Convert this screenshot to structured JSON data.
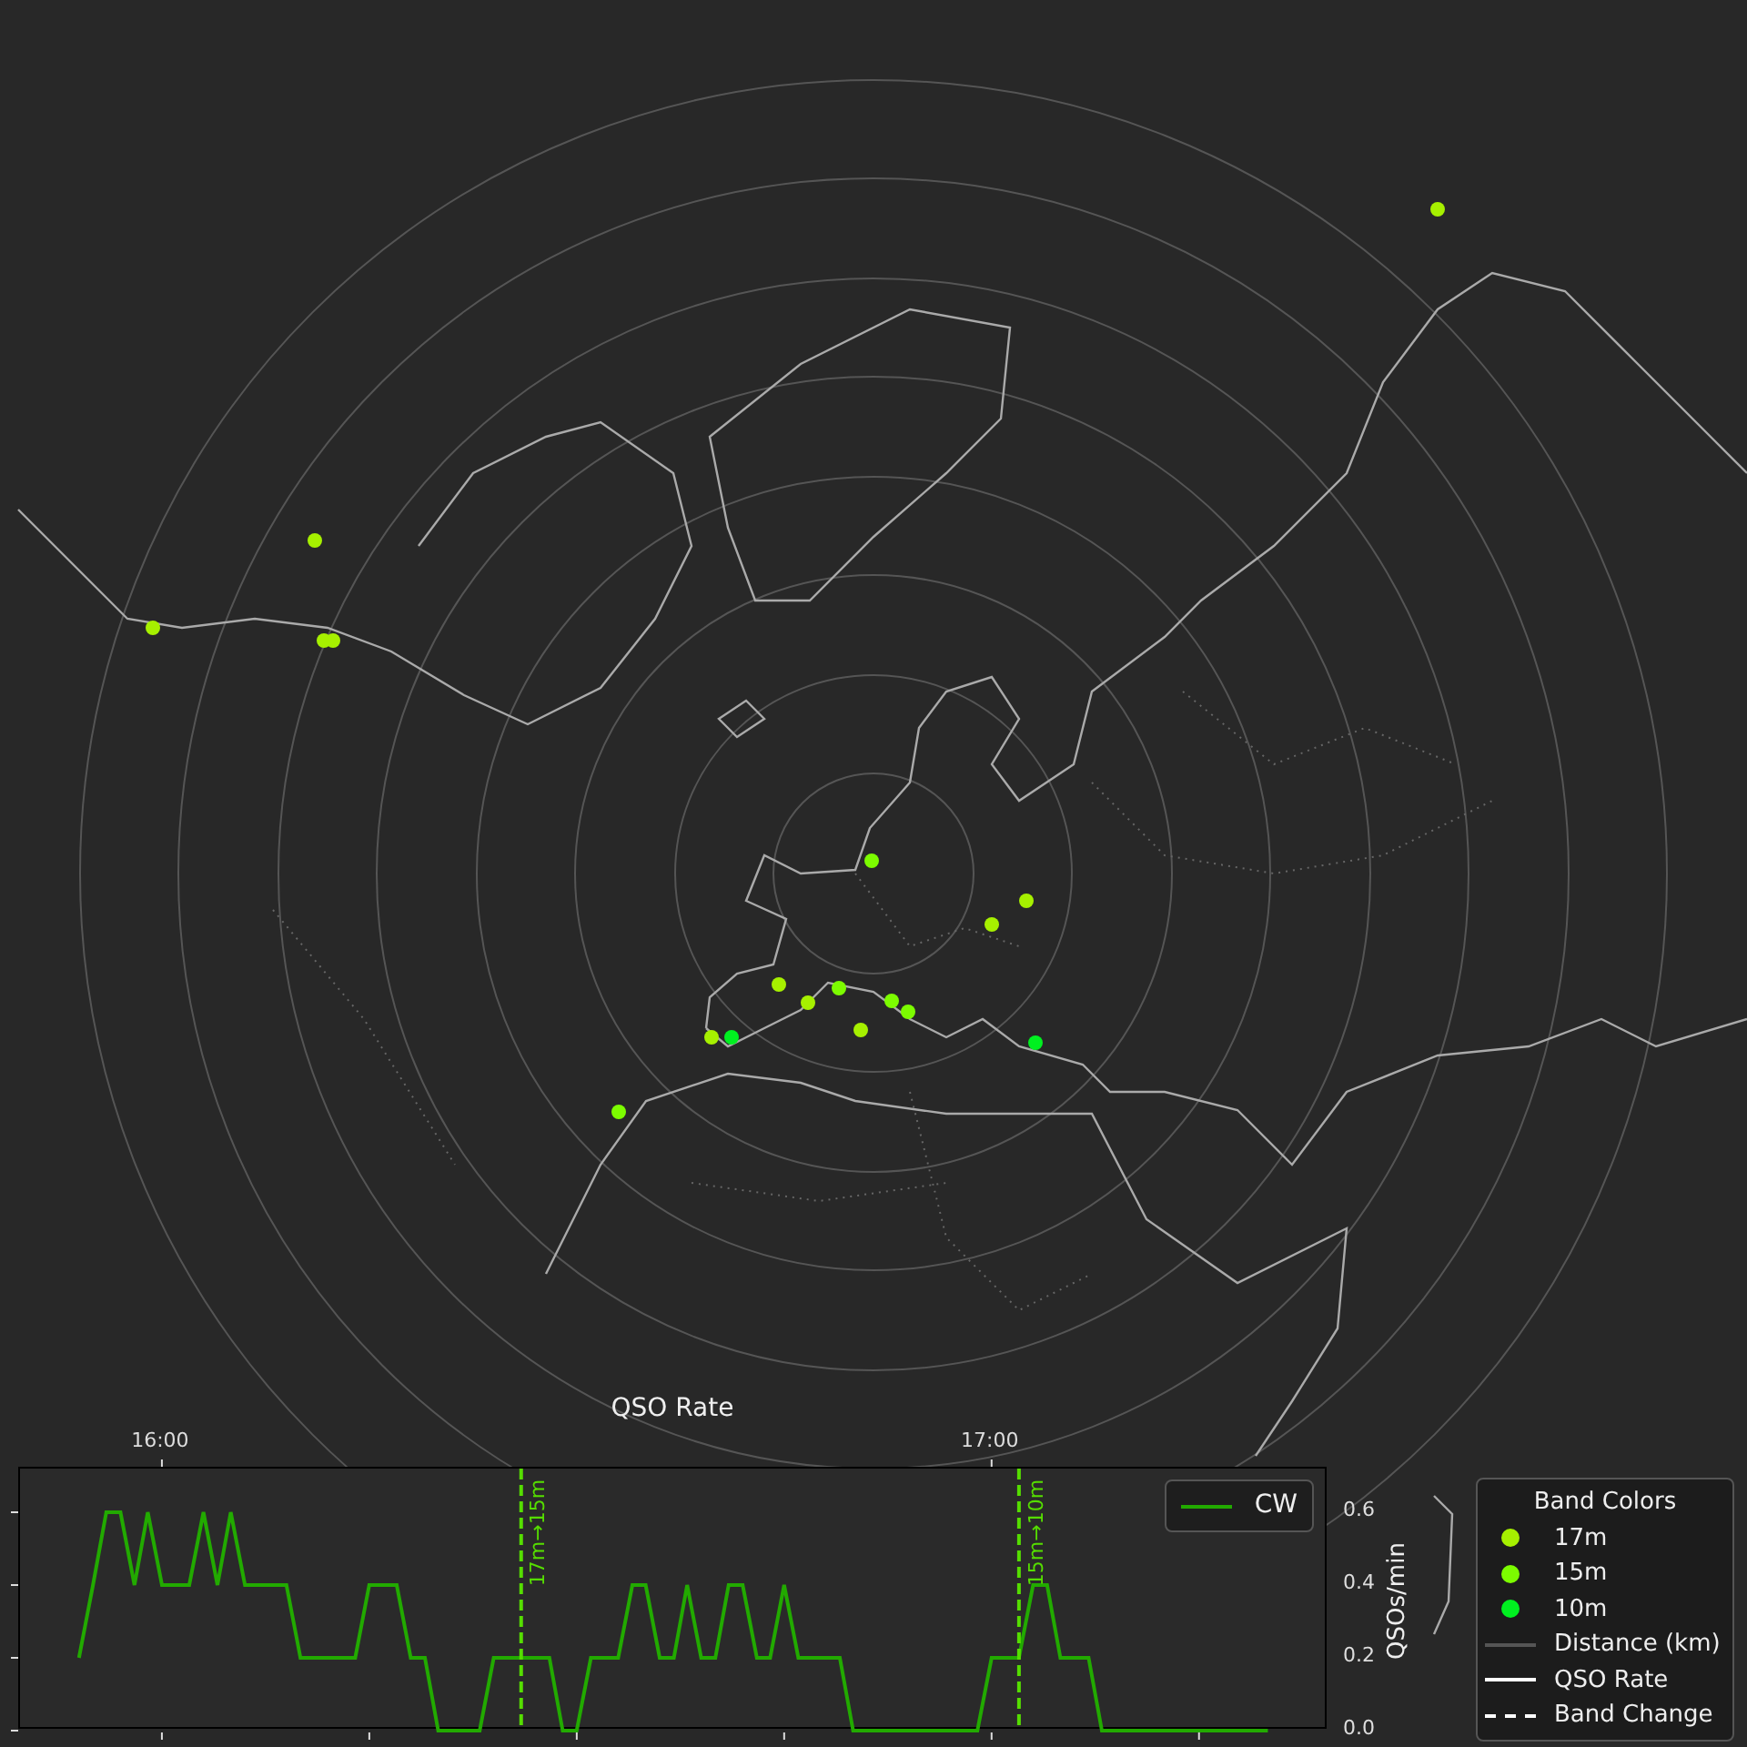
{
  "map": {
    "stations": [
      {
        "color": "#a6f000"
      },
      {
        "color": "#a6f000"
      },
      {
        "color": "#a6f000"
      },
      {
        "color": "#a6f000"
      },
      {
        "color": "#a6f000"
      },
      {
        "color": "#7cfc00"
      },
      {
        "color": "#a6f000"
      },
      {
        "color": "#a6f000"
      },
      {
        "color": "#a6f000"
      },
      {
        "color": "#7cfc00"
      },
      {
        "color": "#a6f000"
      },
      {
        "color": "#7cfc00"
      },
      {
        "color": "#7cfc00"
      },
      {
        "color": "#a6f000"
      },
      {
        "color": "#a6f000"
      },
      {
        "color": "#00f020"
      },
      {
        "color": "#00f020"
      },
      {
        "color": "#7cfc00"
      }
    ]
  },
  "qso_panel": {
    "chart_data": {
      "type": "line",
      "title": "QSO Rate",
      "ylabel": "QSOs/min",
      "x": [
        15.9,
        15.917,
        15.933,
        15.95,
        15.967,
        15.983,
        16,
        16.017,
        16.033,
        16.05,
        16.067,
        16.083,
        16.1,
        16.117,
        16.133,
        16.15,
        16.167,
        16.183,
        16.2,
        16.217,
        16.233,
        16.25,
        16.267,
        16.283,
        16.3,
        16.317,
        16.333,
        16.35,
        16.367,
        16.383,
        16.4,
        16.417,
        16.433,
        16.45,
        16.467,
        16.483,
        16.5,
        16.517,
        16.533,
        16.55,
        16.567,
        16.583,
        16.6,
        16.617,
        16.633,
        16.65,
        16.667,
        16.683,
        16.7,
        16.717,
        16.733,
        16.75,
        16.767,
        16.783,
        16.8,
        16.817,
        16.833,
        16.85,
        16.867,
        16.883,
        16.9,
        16.917,
        16.933,
        16.95,
        16.967,
        16.983,
        17,
        17.017,
        17.033,
        17.05,
        17.067,
        17.083,
        17.1,
        17.117,
        17.133,
        17.15,
        17.167,
        17.183,
        17.2,
        17.217,
        17.233,
        17.25,
        17.267,
        17.283,
        17.3,
        17.317,
        17.333
      ],
      "series": [
        {
          "name": "CW",
          "color": "#22aa00",
          "values": [
            0.2,
            0.4,
            0.6,
            0.6,
            0.4,
            0.6,
            0.4,
            0.4,
            0.4,
            0.6,
            0.4,
            0.6,
            0.4,
            0.4,
            0.4,
            0.4,
            0.2,
            0.2,
            0.2,
            0.2,
            0.2,
            0.4,
            0.4,
            0.4,
            0.2,
            0.2,
            0,
            0,
            0,
            0,
            0.2,
            0.2,
            0.2,
            0.2,
            0.2,
            0,
            0,
            0.2,
            0.2,
            0.2,
            0.4,
            0.4,
            0.2,
            0.2,
            0.4,
            0.2,
            0.2,
            0.4,
            0.4,
            0.2,
            0.2,
            0.4,
            0.2,
            0.2,
            0.2,
            0.2,
            0,
            0,
            0,
            0,
            0,
            0,
            0,
            0,
            0,
            0,
            0.2,
            0.2,
            0.2,
            0.4,
            0.4,
            0.2,
            0.2,
            0.2,
            0,
            0,
            0,
            0,
            0,
            0,
            0,
            0,
            0,
            0,
            0,
            0,
            0
          ]
        }
      ],
      "xlim": [
        15.829,
        17.406
      ],
      "ylim": [
        0,
        0.72
      ],
      "xticks": [
        {
          "value": 16,
          "label": "16:00"
        },
        {
          "value": 17,
          "label": "17:00"
        }
      ],
      "yticks": [
        {
          "value": 0,
          "label": "0.0"
        },
        {
          "value": 0.2,
          "label": "0.2"
        },
        {
          "value": 0.4,
          "label": "0.4"
        },
        {
          "value": 0.6,
          "label": "0.6"
        }
      ],
      "ref_lines": [
        {
          "axis": "x",
          "value": 16.433,
          "label": "17m→15m"
        },
        {
          "axis": "x",
          "value": 17.033,
          "label": "15m→10m"
        }
      ]
    }
  },
  "legend": {
    "title": "Band Colors",
    "items": [
      {
        "kind": "dot",
        "label": "17m",
        "color": "#a6f000"
      },
      {
        "kind": "dot",
        "label": "15m",
        "color": "#7cfc00"
      },
      {
        "kind": "dot",
        "label": "10m",
        "color": "#00f020"
      },
      {
        "kind": "line",
        "label": "Distance (km)",
        "color": "#555555"
      },
      {
        "kind": "line",
        "label": "QSO Rate",
        "color": "#ffffff"
      },
      {
        "kind": "dashed",
        "label": "Band Change",
        "color": "#ffffff"
      }
    ]
  }
}
